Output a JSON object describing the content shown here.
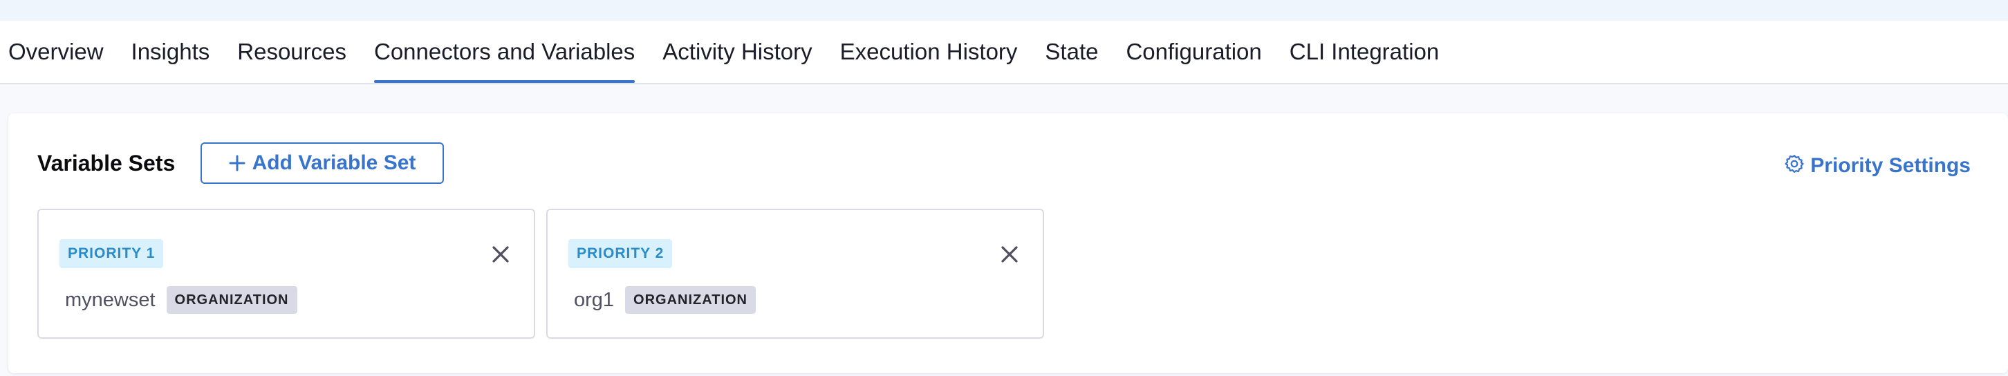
{
  "tabs": [
    {
      "label": "Overview"
    },
    {
      "label": "Insights"
    },
    {
      "label": "Resources"
    },
    {
      "label": "Connectors and Variables",
      "active": true
    },
    {
      "label": "Activity History"
    },
    {
      "label": "Execution History"
    },
    {
      "label": "State"
    },
    {
      "label": "Configuration"
    },
    {
      "label": "CLI Integration"
    }
  ],
  "variable_sets": {
    "title": "Variable Sets",
    "add_button_label": "Add Variable Set",
    "priority_settings_label": "Priority Settings",
    "cards": [
      {
        "priority": "PRIORITY 1",
        "name": "mynewset",
        "scope": "ORGANIZATION"
      },
      {
        "priority": "PRIORITY 2",
        "name": "org1",
        "scope": "ORGANIZATION"
      }
    ]
  },
  "icons": {
    "add": "plus-icon",
    "settings": "gear-icon",
    "remove": "close-icon"
  },
  "colors": {
    "accent": "#3874cb",
    "priority_badge_bg": "#d8f1fc",
    "priority_badge_text": "#2a8bc9",
    "scope_badge_bg": "#d9dae5"
  }
}
